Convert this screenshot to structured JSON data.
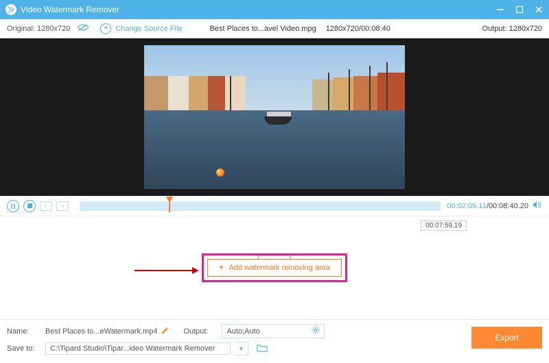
{
  "titlebar": {
    "title": "Video Watermark Remover"
  },
  "toolbar": {
    "original_label": "Original: 1280x720",
    "change_source_label": "Change Source File",
    "filename": "Best Places to...avel Video.mpg",
    "dimensions_duration": "1280x720/00:08:40",
    "output_label": "Output: 1280x720"
  },
  "playback": {
    "current_time": "00:02:05.11",
    "duration": "/00:08:40.20"
  },
  "dropzone": {
    "timestamp_badge": "00:07:59.19",
    "add_button_label": "Add watermark removing area"
  },
  "bottom": {
    "name_label": "Name:",
    "name_value": "Best Places to...eWatermark.mp4",
    "output_label": "Output:",
    "output_value": "Auto;Auto",
    "saveto_label": "Save to:",
    "saveto_value": "C:\\Tipard Studio\\Tipar...ideo Watermark Remover",
    "export_label": "Export"
  }
}
